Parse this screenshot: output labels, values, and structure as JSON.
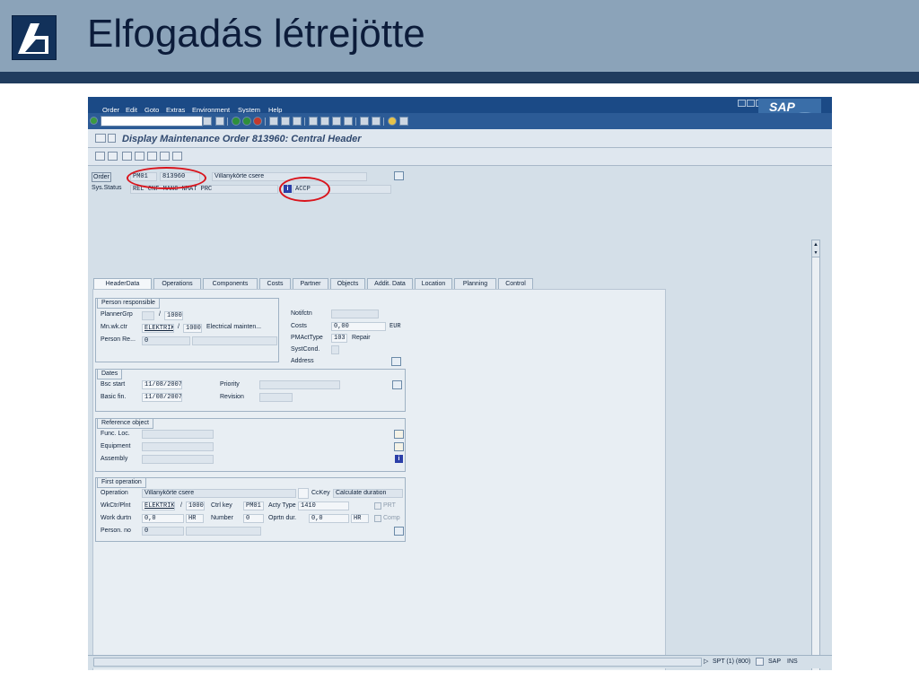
{
  "slide": {
    "title": "Elfogadás létrejötte"
  },
  "sap": {
    "menu": [
      "Order",
      "Edit",
      "Goto",
      "Extras",
      "Environment",
      "System",
      "Help"
    ],
    "logo": "SAP",
    "window_title": "Display Maintenance Order 813960: Central Header"
  },
  "header": {
    "order_label": "Order",
    "order_type": "PM01",
    "order_number": "813960",
    "order_text": "Villanykörte csere",
    "sys_status_label": "Sys.Status",
    "sys_status_value": "REL  CNF  MANC NMAT PRC",
    "user_status_value": "ACCP"
  },
  "tabs": [
    "HeaderData",
    "Operations",
    "Components",
    "Costs",
    "Partner",
    "Objects",
    "Addit. Data",
    "Location",
    "Planning",
    "Control"
  ],
  "person_responsible": {
    "title": "Person responsible",
    "planner_grp_label": "PlannerGrp",
    "planner_grp_sep": "/",
    "planner_plant": "1000",
    "mn_wk_ctr_label": "Mn.wk.ctr",
    "mn_wk_ctr_value": "ELEKTRIK",
    "mn_wk_ctr_sep": "/",
    "mn_wk_ctr_plant": "1000",
    "mn_wk_ctr_desc": "Electrical mainten...",
    "person_resp_label": "Person Re...",
    "person_resp_value": "0"
  },
  "right_info": {
    "notifctn_label": "Notifctn",
    "costs_label": "Costs",
    "costs_value": "0,00",
    "costs_currency": "EUR",
    "pm_act_type_label": "PMActType",
    "pm_act_type_value": "103",
    "pm_act_type_desc": "Repair",
    "syst_cond_label": "SystCond.",
    "address_label": "Address"
  },
  "dates": {
    "title": "Dates",
    "bsc_start_label": "Bsc start",
    "bsc_start_value": "11/08/2007",
    "basic_fin_label": "Basic fin.",
    "basic_fin_value": "11/08/2007",
    "priority_label": "Priority",
    "revision_label": "Revision"
  },
  "reference_object": {
    "title": "Reference object",
    "func_loc_label": "Func. Loc.",
    "equipment_label": "Equipment",
    "assembly_label": "Assembly"
  },
  "first_operation": {
    "title": "First operation",
    "operation_label": "Operation",
    "operation_value": "Villanykörte csere",
    "cc_key_label": "CcKey",
    "cc_key_value": "Calculate duration",
    "wk_ctr_plnt_label": "WkCtr/Plnt",
    "wk_ctr_value": "ELEKTRIK",
    "wk_ctr_sep": "/",
    "wk_ctr_plant": "1000",
    "ctrl_key_label": "Ctrl key",
    "ctrl_key_value": "PM01",
    "acty_type_label": "Acty Type",
    "acty_type_value": "1410",
    "prt_label": "PRT",
    "work_durtn_label": "Work durtn",
    "work_durtn_value": "0,0",
    "work_unit": "HR",
    "number_label": "Number",
    "number_value": "0",
    "oprtn_dur_label": "Oprtn dur.",
    "oprtn_dur_value": "0,0",
    "oprtn_unit": "HR",
    "comp_label": "Comp",
    "person_no_label": "Person. no",
    "person_no_value": "0"
  },
  "status_bar": {
    "system_info": "SPT (1) (800)",
    "server": "SAP",
    "mode": "INS"
  }
}
